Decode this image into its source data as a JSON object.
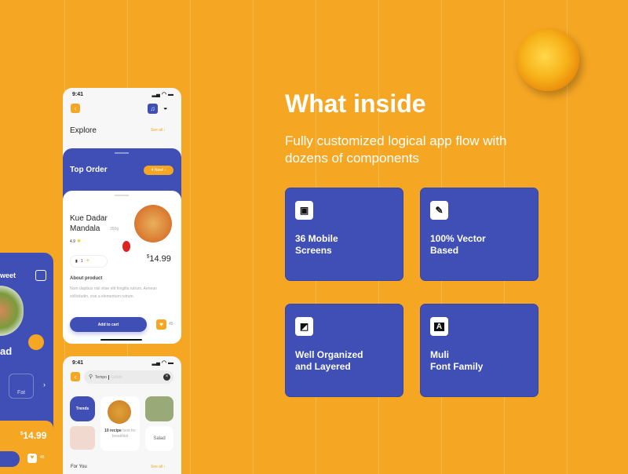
{
  "colors": {
    "background": "#F5A623",
    "primary": "#3F4FB5",
    "white": "#FFFFFF"
  },
  "hero": {
    "title": "What inside",
    "subtitle_line1": "Fully customized logical app flow with",
    "subtitle_line2": "dozens of components"
  },
  "features": [
    {
      "icon": "mobile-screen-icon",
      "line1": "36 Mobile",
      "line2": "Screens"
    },
    {
      "icon": "pencil-icon",
      "line1": "100% Vector",
      "line2": "Based"
    },
    {
      "icon": "layers-icon",
      "line1": "Well Organized",
      "line2": "and Layered"
    },
    {
      "icon": "font-icon",
      "glyph": "A",
      "line1": "Muli",
      "line2": "Font Family"
    }
  ],
  "phone_left": {
    "title_fragment": "weet",
    "name_fragment": "ad",
    "nutrient": "Fat",
    "price_currency": "$",
    "price": "14.99",
    "likes": "45"
  },
  "phone_detail": {
    "time": "9:41",
    "explore": "Explore",
    "see_all": "See all",
    "top_order": "Top Order",
    "new_badge": "4 New!",
    "product_name_line1": "Kue Dadar",
    "product_name_line2": "Mandala",
    "weight": "350g",
    "rating": "4.9",
    "quantity": "1",
    "price_currency": "$",
    "price": "14.99",
    "about_title": "About product",
    "about_text": "Nom dapibus nisl vitae elit fringilla rutrum. Aenean sollicitudin, erat a elementum rutrum.",
    "add_to_cart": "Add to cart",
    "likes": "45"
  },
  "phone_search": {
    "time": "9:41",
    "search_value": "Tempo",
    "search_placeholder": "Gelato",
    "trends": "Trends",
    "recipe_bold": "10 recipe",
    "recipe_rest": "best for breakfast",
    "salad": "Salad",
    "for_you": "For You",
    "see_all": "See all"
  }
}
